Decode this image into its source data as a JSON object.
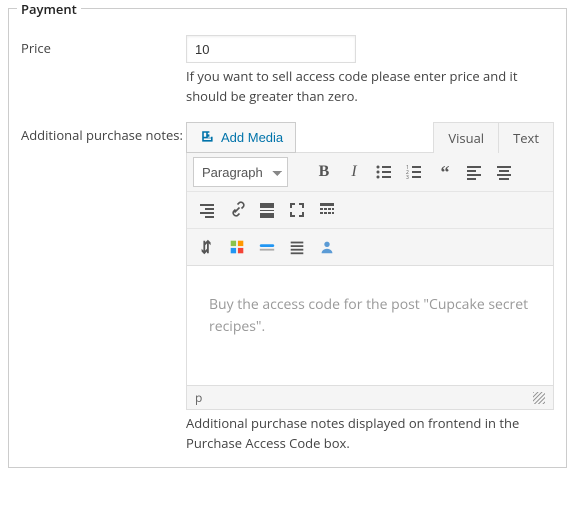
{
  "panel": {
    "title": "Payment"
  },
  "price": {
    "label": "Price",
    "value": "10",
    "help": "If you want to sell access code please enter price and it should be greater than zero."
  },
  "notes": {
    "label": "Additional purchase notes:",
    "add_media": "Add Media",
    "tab_visual": "Visual",
    "tab_text": "Text",
    "format": "Paragraph",
    "content": "Buy the access code for the post \"Cupcake secret recipes\".",
    "status_path": "p",
    "help": "Additional purchase notes displayed on frontend in the Purchase Access Code box."
  }
}
